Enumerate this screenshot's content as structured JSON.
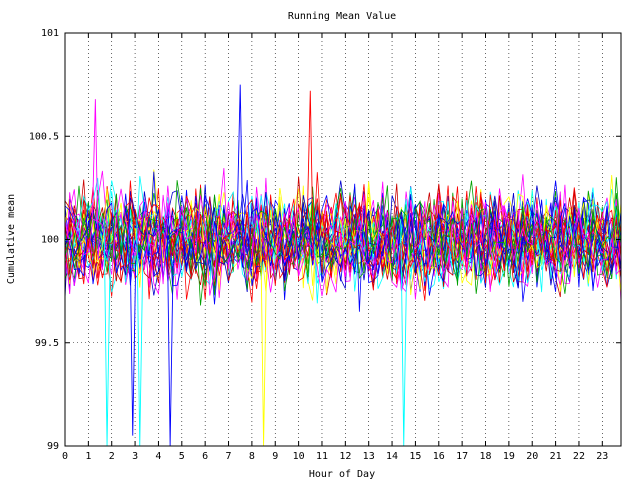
{
  "chart_data": {
    "type": "line",
    "title": "Running Mean Value",
    "xlabel": "Hour of Day",
    "ylabel": "Cumulative mean",
    "xlim": [
      0,
      23.8
    ],
    "ylim": [
      99,
      101
    ],
    "x_ticks": [
      "0",
      "1",
      "2",
      "3",
      "4",
      "5",
      "6",
      "7",
      "8",
      "9",
      "10",
      "11",
      "12",
      "13",
      "14",
      "15",
      "16",
      "17",
      "18",
      "19",
      "20",
      "21",
      "22",
      "23"
    ],
    "y_ticks": [
      "99",
      "99.5",
      "100",
      "100.5",
      "101"
    ],
    "grid": true,
    "legend": "none",
    "center_value": 100,
    "noise_amplitude": 0.25,
    "series_count": 36,
    "points_per_series": 120,
    "series_colors": [
      "#ff0000",
      "#0000ff",
      "#00a000",
      "#ff00ff",
      "#ffff00",
      "#00ffff",
      "#cc0000",
      "#0000cc"
    ],
    "outliers": [
      {
        "x": 1.8,
        "y": 99.0,
        "color": "#00ffff"
      },
      {
        "x": 3.2,
        "y": 99.0,
        "color": "#00ffff"
      },
      {
        "x": 4.5,
        "y": 99.0,
        "color": "#0000ff"
      },
      {
        "x": 8.5,
        "y": 99.0,
        "color": "#ffff00"
      },
      {
        "x": 14.5,
        "y": 99.0,
        "color": "#00ffff"
      },
      {
        "x": 2.9,
        "y": 99.05,
        "color": "#0000ff"
      },
      {
        "x": 7.5,
        "y": 100.75,
        "color": "#0000ff"
      },
      {
        "x": 10.5,
        "y": 100.72,
        "color": "#ff0000"
      },
      {
        "x": 1.3,
        "y": 100.68,
        "color": "#ff00ff"
      }
    ]
  }
}
